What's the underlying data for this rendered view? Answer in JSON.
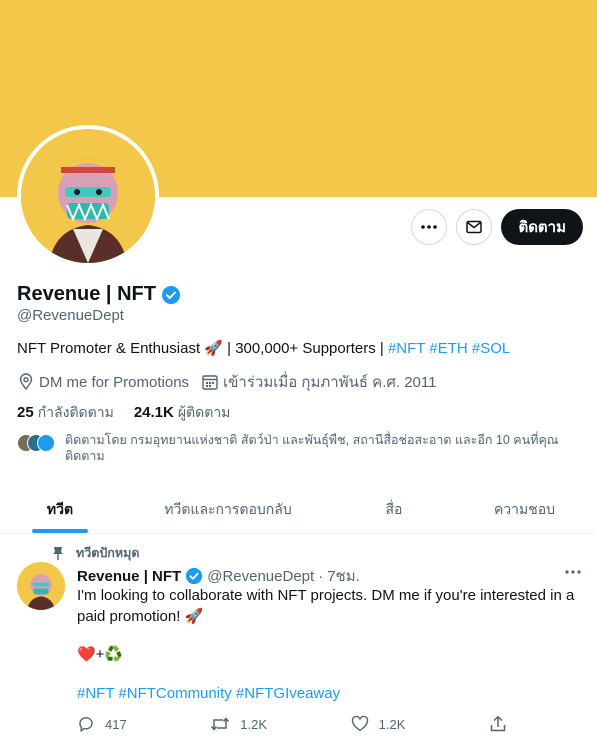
{
  "profile": {
    "name": "Revenue | NFT",
    "handle": "@RevenueDept",
    "bio_text": "NFT Promoter & Enthusiast 🚀 | 300,000+ Supporters | ",
    "bio_tags": [
      "#NFT",
      "#ETH",
      "#SOL"
    ],
    "location": "DM me for Promotions",
    "joined": "เข้าร่วมเมื่อ กุมภาพันธ์ ค.ศ. 2011",
    "following_count": "25",
    "following_label": "กำลังติดตาม",
    "followers_count": "24.1K",
    "followers_label": "ผู้ติดตาม",
    "followed_by": "ติดตามโดย กรมอุทยานแห่งชาติ สัตว์ป่า และพันธุ์พืช, สถานีสื่อช่อสะอาด และอีก 10 คนที่คุณติดตาม"
  },
  "actions": {
    "more_icon": "ellipsis-icon",
    "message_icon": "envelope-icon",
    "follow_label": "ติดตาม"
  },
  "tabs": [
    "ทวีต",
    "ทวีตและการตอบกลับ",
    "สื่อ",
    "ความชอบ"
  ],
  "tweet": {
    "pinned_label": "ทวีตปักหมุด",
    "name": "Revenue | NFT",
    "handle": "@RevenueDept",
    "time": "7ชม.",
    "text": "I'm looking to collaborate with NFT projects. DM me if you're interested in a paid promotion! 🚀",
    "emoji_line": "❤️+♻️",
    "tags": "#NFT #NFTCommunity #NFTGIveaway",
    "replies": "417",
    "retweets": "1.2K",
    "likes": "1.2K"
  },
  "colors": {
    "banner": "#f3c84a",
    "accent": "#1d9bf0",
    "text": "#0f1419",
    "muted": "#536471"
  }
}
